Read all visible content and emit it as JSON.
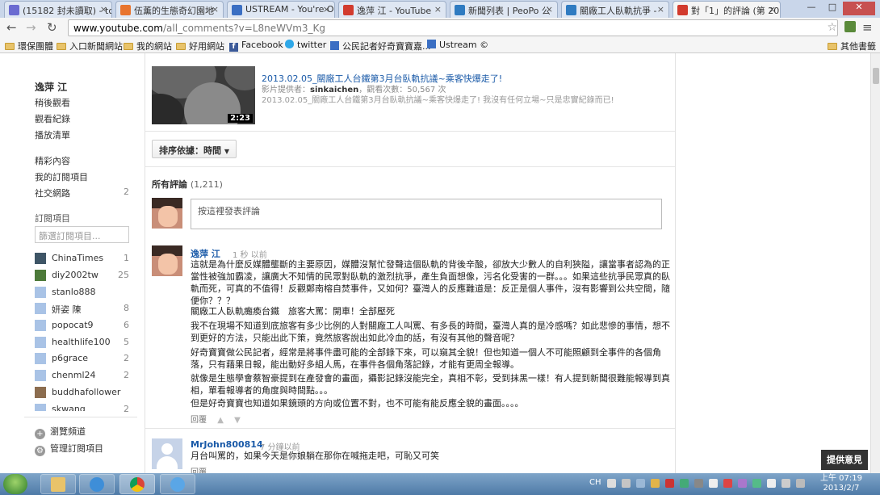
{
  "tabs": [
    {
      "label": "(15182 封未讀取) - tc",
      "color": "#6b6bd1"
    },
    {
      "label": "伍薰的生態奇幻園地",
      "color": "#e8742e"
    },
    {
      "label": "USTREAM - You're O",
      "color": "#3b6fc3"
    },
    {
      "label": "逸萍 江 - YouTube",
      "color": "#d23b2e"
    },
    {
      "label": "新聞列表 | PeoPo 公",
      "color": "#2f7bc1"
    },
    {
      "label": "關廠工人臥軌抗爭 - ",
      "color": "#2f7bc1"
    },
    {
      "label": "對「1」的評論 (第 20",
      "color": "#d23b2e"
    }
  ],
  "toolbar": {
    "url_host": "www.youtube.com",
    "url_path": "/all_comments?v=L8neWVm3_Kg"
  },
  "bookmarks": [
    {
      "label": "環保團體",
      "icon": "folder-icon"
    },
    {
      "label": "入口新聞網站",
      "icon": "folder-icon"
    },
    {
      "label": "我的網站",
      "icon": "folder-icon"
    },
    {
      "label": "好用網站",
      "icon": "folder-icon"
    },
    {
      "label": "Facebook",
      "icon": "facebook-icon"
    },
    {
      "label": "twitter",
      "icon": "twitter-icon"
    },
    {
      "label": "公民記者好奇寶寶嘉...",
      "icon": "ustream-icon"
    },
    {
      "label": "Ustream ©",
      "icon": "ustream-icon"
    },
    {
      "label": "其他書籤",
      "icon": "folder-icon"
    }
  ],
  "sidebar": {
    "user_name": "逸萍 江",
    "links": [
      "稍後觀看",
      "觀看紀錄",
      "播放清單"
    ],
    "links2": [
      {
        "label": "精彩內容",
        "count": ""
      },
      {
        "label": "我的訂閱項目",
        "count": ""
      },
      {
        "label": "社交網路",
        "count": "2"
      }
    ],
    "subs_heading": "訂閱項目",
    "filter_placeholder": "篩選訂閱項目...",
    "subscriptions": [
      {
        "name": "ChinaTimes",
        "count": "1",
        "color": "#3e5566"
      },
      {
        "name": "diy2002tw",
        "count": "25",
        "color": "#4d7a3a"
      },
      {
        "name": "stanlo888",
        "count": "",
        "color": "#a9c3e6"
      },
      {
        "name": "妍姿 陳",
        "count": "8",
        "color": "#a9c3e6"
      },
      {
        "name": "popocat9",
        "count": "6",
        "color": "#a9c3e6"
      },
      {
        "name": "healthlife100",
        "count": "5",
        "color": "#a9c3e6"
      },
      {
        "name": "p6grace",
        "count": "2",
        "color": "#a9c3e6"
      },
      {
        "name": "chenml24",
        "count": "2",
        "color": "#a9c3e6"
      },
      {
        "name": "buddhafollower",
        "count": "",
        "color": "#8c6d4f"
      },
      {
        "name": "skwang",
        "count": "2",
        "color": "#a9c3e6"
      }
    ],
    "browse_channels": "瀏覽頻道",
    "manage_subs": "管理訂閱項目"
  },
  "video": {
    "duration": "2:23",
    "title": "2013.02.05_關廠工人台鐵第3月台臥軌抗議~乘客快爆走了!",
    "uploader_label": "影片提供者：",
    "uploader": "sinkaichen",
    "views": "，觀看次數：50,567 次",
    "description": "2013.02.05_關廠工人台鐵第3月台臥軌抗議~乘客快爆走了! 我沒有任何立場~只是忠實紀錄而已!"
  },
  "sort_label": "排序依據：時間",
  "all_comments_label": "所有評論",
  "comment_count": "(1,211)",
  "comment_input_placeholder": "按這裡發表評論",
  "comments": [
    {
      "author": "逸萍 江",
      "time": "1 秒 以前",
      "paras": [
        "這就是為什麼反媒體壟斷的主要原因，媒體沒幫忙發聲這個臥軌的背後辛酸，卻放大少數人的自利狹隘，讓當事者認為的正當性被強加霸凌，讓廣大不知情的民眾對臥軌的激烈抗爭，產生負面想像，污名化受害的一群。。。如果這些抗爭民眾真的臥軌而死，可真的不值得！反觀鄭南榕自焚事件，又如何？臺灣人的反應難道是：反正是個人事件，沒有影響到公共空間，隨便你？？？",
        "關廠工人臥軌癱瘓台鐵　旅客大罵：開車！全部壓死",
        "我不在現場不知道到底旅客有多少比例的人對關廠工人叫罵、有多長的時間，臺灣人真的是冷感嗎？如此悲慘的事情，想不到更好的方法，只能出此下策，竟然旅客說出如此冷血的話，有沒有其他的聲音呢？",
        "好奇寶寶做公民記者，經常是將事件盡可能的全部錄下來，可以窺其全貌！但也知道一個人不可能照顧到全事件的各個角落，只有藉果日報，能出動好多組人馬，在事件各個角落記錄，才能有更周全報導。",
        "就像是生態學會蔡智豪提到在產發會的畫面，攝影記錄沒能完全，真相不彰，受到抹黑一樣！有人提到新聞很難能報導到真相，單看報導者的角度與時間點。。。",
        "但是好奇寶寶也知道如果鏡頭的方向或位置不對，也不可能有能反應全貌的畫面。。。。"
      ],
      "reply_label": "回覆"
    },
    {
      "author": "MrJohn800814",
      "time": "7 分鐘以前",
      "paras": [
        "月台叫罵的，如果今天是你娘躺在那你在喊拖走吧，可恥又可笑"
      ],
      "reply_label": "回覆"
    }
  ],
  "feedback_label": "提供意見",
  "taskbar": {
    "lang": "CH",
    "time": "上午 07:19",
    "date": "2013/2/7"
  }
}
